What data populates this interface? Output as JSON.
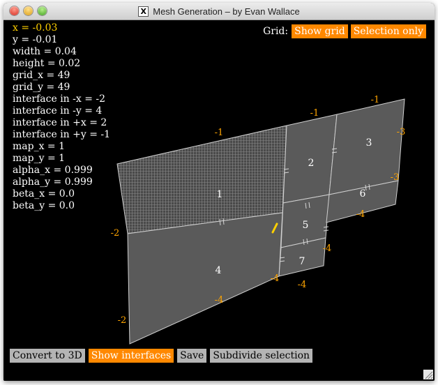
{
  "window": {
    "title": "Mesh Generation – by Evan Wallace",
    "title_icon": "X"
  },
  "params": [
    "x = -0.03",
    "y = -0.01",
    "width = 0.04",
    "height = 0.02",
    "grid_x = 49",
    "grid_y = 49",
    "interface in -x = -2",
    "interface in -y = 4",
    "interface in +x = 2",
    "interface in +y = -1",
    "map_x = 1",
    "map_y = 1",
    "alpha_x = 0.999",
    "alpha_y = 0.999",
    "beta_x = 0.0",
    "beta_y = 0.0"
  ],
  "grid_bar": {
    "label": "Grid:",
    "show_grid": "Show grid",
    "selection_only": "Selection only"
  },
  "toolbar": {
    "convert": "Convert to 3D",
    "show_interfaces": "Show interfaces",
    "save": "Save",
    "subdivide": "Subdivide selection"
  },
  "patches": [
    "1",
    "2",
    "3",
    "4",
    "5",
    "6",
    "7"
  ],
  "edge_labels": [
    "-1",
    "-1",
    "-1",
    "-3",
    "-3",
    "-2",
    "-2",
    "-4",
    "-4",
    "-4",
    "-4",
    "-4"
  ],
  "colors": {
    "highlight": "#ffd000",
    "button_on": "#ff8800",
    "button_off": "#b4b4b4",
    "patch": "#5a5a5a",
    "edge_label": "#ffa500"
  }
}
